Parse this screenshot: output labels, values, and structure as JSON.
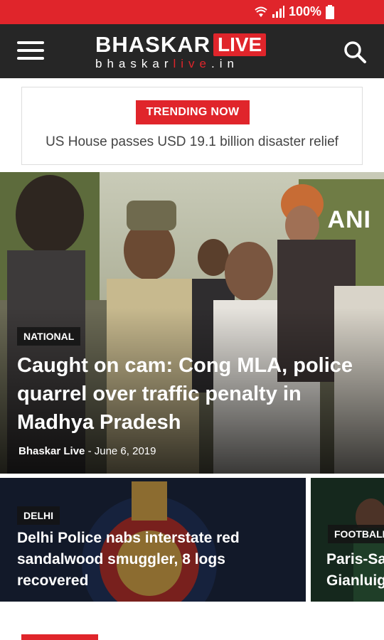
{
  "status_bar": {
    "battery": "100%"
  },
  "header": {
    "logo_brand": "BHASKAR",
    "logo_live": "LIVE",
    "logo_url_a": "bhaskar",
    "logo_url_b": "live",
    "logo_url_c": ".in"
  },
  "trending": {
    "label": "TRENDING NOW",
    "headline": "US House passes USD 19.1 billion disaster relief"
  },
  "hero": {
    "watermark": "ANI",
    "category": "NATIONAL",
    "title": "Caught on cam: Cong MLA, police quarrel over traffic penalty in Madhya Pradesh",
    "author": "Bhaskar Live",
    "separator": "-",
    "date": "June 6, 2019"
  },
  "cards": [
    {
      "category": "DELHI",
      "title": "Delhi Police nabs interstate red sandalwood smuggler, 8 logs recovered"
    },
    {
      "category": "FOOTBALL",
      "title": "Paris-Sa Gianluig"
    }
  ],
  "colors": {
    "brand_red": "#e0252b",
    "header_bg": "#262626"
  }
}
